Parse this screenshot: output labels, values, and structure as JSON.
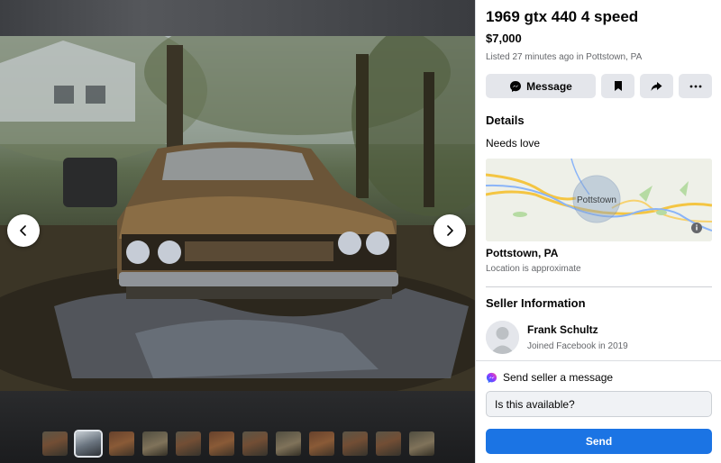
{
  "listing": {
    "title": "1969 gtx 440 4 speed",
    "price": "$7,000",
    "listed": "Listed 27 minutes ago in Pottstown, PA"
  },
  "actions": {
    "message_label": "Message",
    "save_icon": "bookmark-icon",
    "share_icon": "share-icon",
    "more_icon": "more-icon"
  },
  "details": {
    "heading": "Details",
    "description": "Needs love",
    "map_label": "Pottstown",
    "location": "Pottstown, PA",
    "location_note": "Location is approximate"
  },
  "seller": {
    "heading": "Seller Information",
    "name": "Frank Schultz",
    "joined": "Joined Facebook in 2019"
  },
  "compose": {
    "heading": "Send seller a message",
    "input_value": "Is this available?",
    "send_label": "Send"
  },
  "gallery": {
    "thumbnail_count": 12,
    "active_index": 2
  },
  "colors": {
    "accent": "#1b74e4",
    "button_bg": "#e4e6eb",
    "secondary_text": "#65676b"
  }
}
